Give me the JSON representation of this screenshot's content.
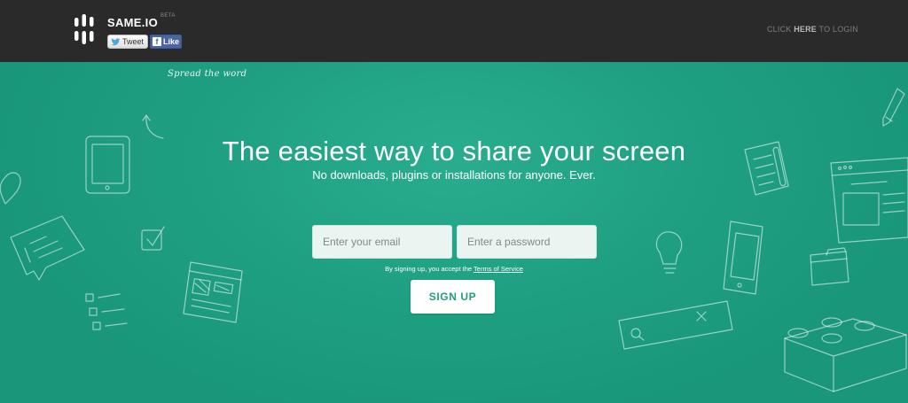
{
  "header": {
    "brand": "SAME.IO",
    "beta": "BETA",
    "tweet_label": "Tweet",
    "like_label": "Like",
    "login_prefix": "CLICK ",
    "login_strong": "HERE",
    "login_suffix": " TO LOGIN",
    "spread_text": "Spread the word"
  },
  "hero": {
    "headline": "The easiest way to share your screen",
    "subline": "No downloads, plugins or installations for anyone. Ever."
  },
  "form": {
    "email_placeholder": "Enter your email",
    "password_placeholder": "Enter a password",
    "terms_prefix": "By signing up, you accept the ",
    "terms_link": "Terms of Service",
    "signup_label": "SIGN UP"
  },
  "colors": {
    "topbar": "#2a2a2a",
    "hero": "#1e9e80",
    "button_text": "#1e9e80"
  }
}
